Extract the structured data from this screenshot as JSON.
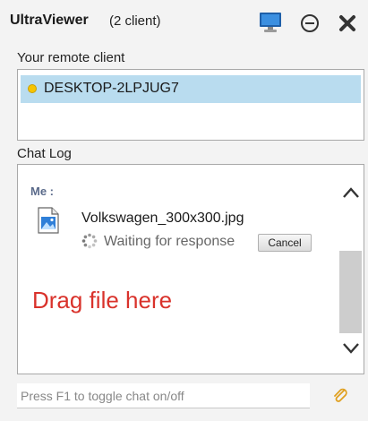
{
  "window": {
    "app_name": "UltraViewer",
    "client_count": "(2 client)",
    "icons": [
      "monitor-icon",
      "minimize-icon",
      "close-icon"
    ]
  },
  "remote": {
    "label": "Your remote client",
    "clients": [
      {
        "name": "DESKTOP-2LPJUG7",
        "status_color": "#f7c400"
      }
    ]
  },
  "chat": {
    "label": "Chat Log",
    "sender": "Me :",
    "file_name": "Volkswagen_300x300.jpg",
    "status_text": "Waiting for response",
    "cancel_label": "Cancel",
    "drag_hint": "Drag file here"
  },
  "input": {
    "placeholder": "Press F1 to toggle chat on/off",
    "value": ""
  },
  "colors": {
    "accent": "#b9dcef",
    "drag_hint": "#d9322b",
    "attach": "#e0a020"
  }
}
